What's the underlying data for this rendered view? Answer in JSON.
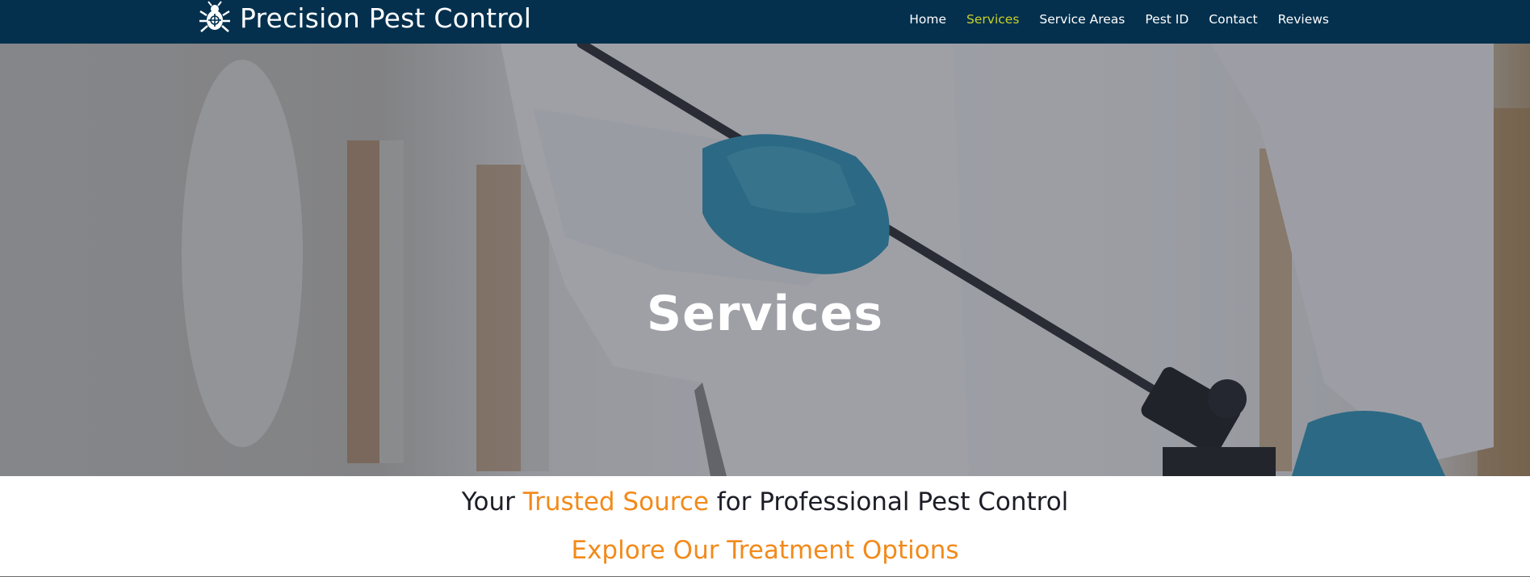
{
  "header": {
    "brand_name": "Precision Pest Control",
    "logo_icon": "bug-crosshair-icon"
  },
  "nav": {
    "items": [
      {
        "label": "Home",
        "active": false
      },
      {
        "label": "Services",
        "active": true
      },
      {
        "label": "Service Areas",
        "active": false
      },
      {
        "label": "Pest ID",
        "active": false
      },
      {
        "label": "Contact",
        "active": false
      },
      {
        "label": "Reviews",
        "active": false
      }
    ]
  },
  "hero": {
    "title": "Services"
  },
  "intro": {
    "tagline_pre": "Your ",
    "tagline_accent": "Trusted Source",
    "tagline_post": " for Professional Pest Control",
    "subheading": "Explore Our Treatment Options"
  },
  "colors": {
    "header_bg": "#04304e",
    "nav_active": "#c8d22a",
    "accent_orange": "#f28a1a",
    "text_dark": "#1d1d27"
  }
}
